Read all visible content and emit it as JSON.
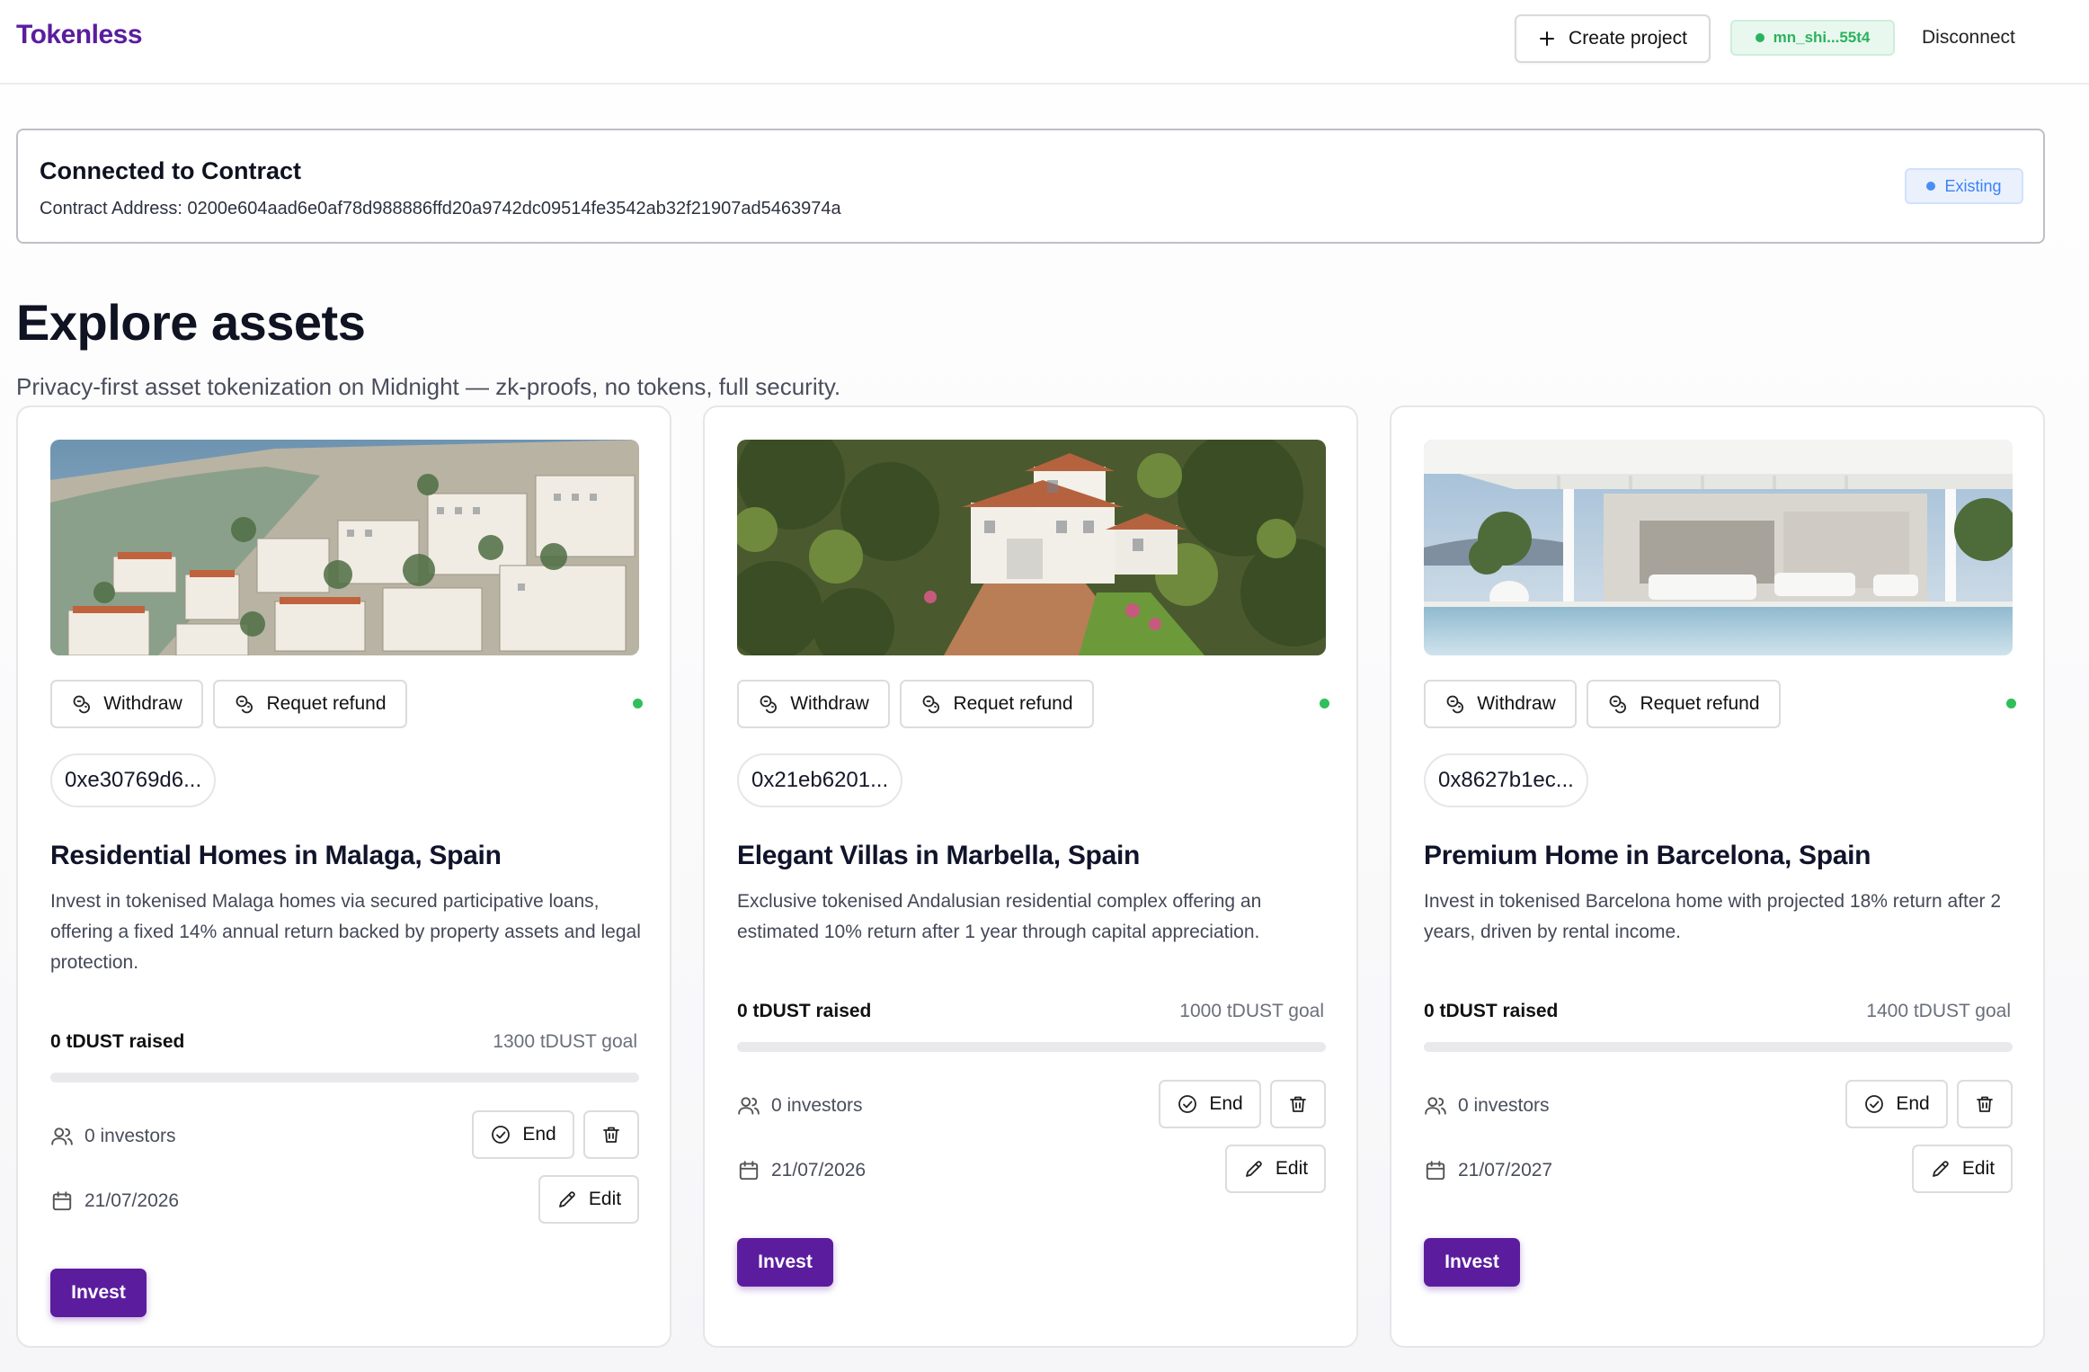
{
  "app": {
    "brand": "Tokenless",
    "create_project_label": "Create project",
    "wallet_address": "mn_shi...55t4",
    "disconnect_label": "Disconnect"
  },
  "contract": {
    "title": "Connected to Contract",
    "address_line": "Contract Address: 0200e604aad6e0af78d988886ffd20a9742dc09514fe3542ab32f21907ad5463974a",
    "status": "Existing"
  },
  "page": {
    "title": "Explore assets",
    "subtitle": "Privacy-first asset tokenization on Midnight — zk-proofs, no tokens, full security."
  },
  "labels": {
    "withdraw": "Withdraw",
    "refund": "Requet refund",
    "end": "End",
    "edit": "Edit",
    "invest": "Invest"
  },
  "colors": {
    "brand": "#5b1d9e",
    "status_active": "#2fbf5b",
    "wallet_green": "#2ab35e",
    "existing_blue": "#3b82f6"
  },
  "assets": [
    {
      "id": "0xe30769d6...",
      "title": "Residential Homes in Malaga, Spain",
      "description": "Invest in tokenised Malaga homes via secured participative loans, offering a fixed 14% annual return backed by property assets and legal protection.",
      "raised": "0 tDUST raised",
      "goal": "1300 tDUST goal",
      "progress": 0,
      "investors": "0 investors",
      "date": "21/07/2026",
      "image": "coastal-town-photo"
    },
    {
      "id": "0x21eb6201...",
      "title": "Elegant Villas in Marbella, Spain",
      "description": "Exclusive tokenised Andalusian residential complex offering an estimated 10% return after 1 year through capital appreciation.",
      "raised": "0 tDUST raised",
      "goal": "1000 tDUST goal",
      "progress": 0,
      "investors": "0 investors",
      "date": "21/07/2026",
      "image": "villa-garden-photo"
    },
    {
      "id": "0x8627b1ec...",
      "title": "Premium Home in Barcelona, Spain",
      "description": "Invest in tokenised Barcelona home with projected 18% return after 2 years, driven by rental income.",
      "raised": "0 tDUST raised",
      "goal": "1400 tDUST goal",
      "progress": 0,
      "investors": "0 investors",
      "date": "21/07/2027",
      "image": "modern-pool-house-photo"
    }
  ]
}
